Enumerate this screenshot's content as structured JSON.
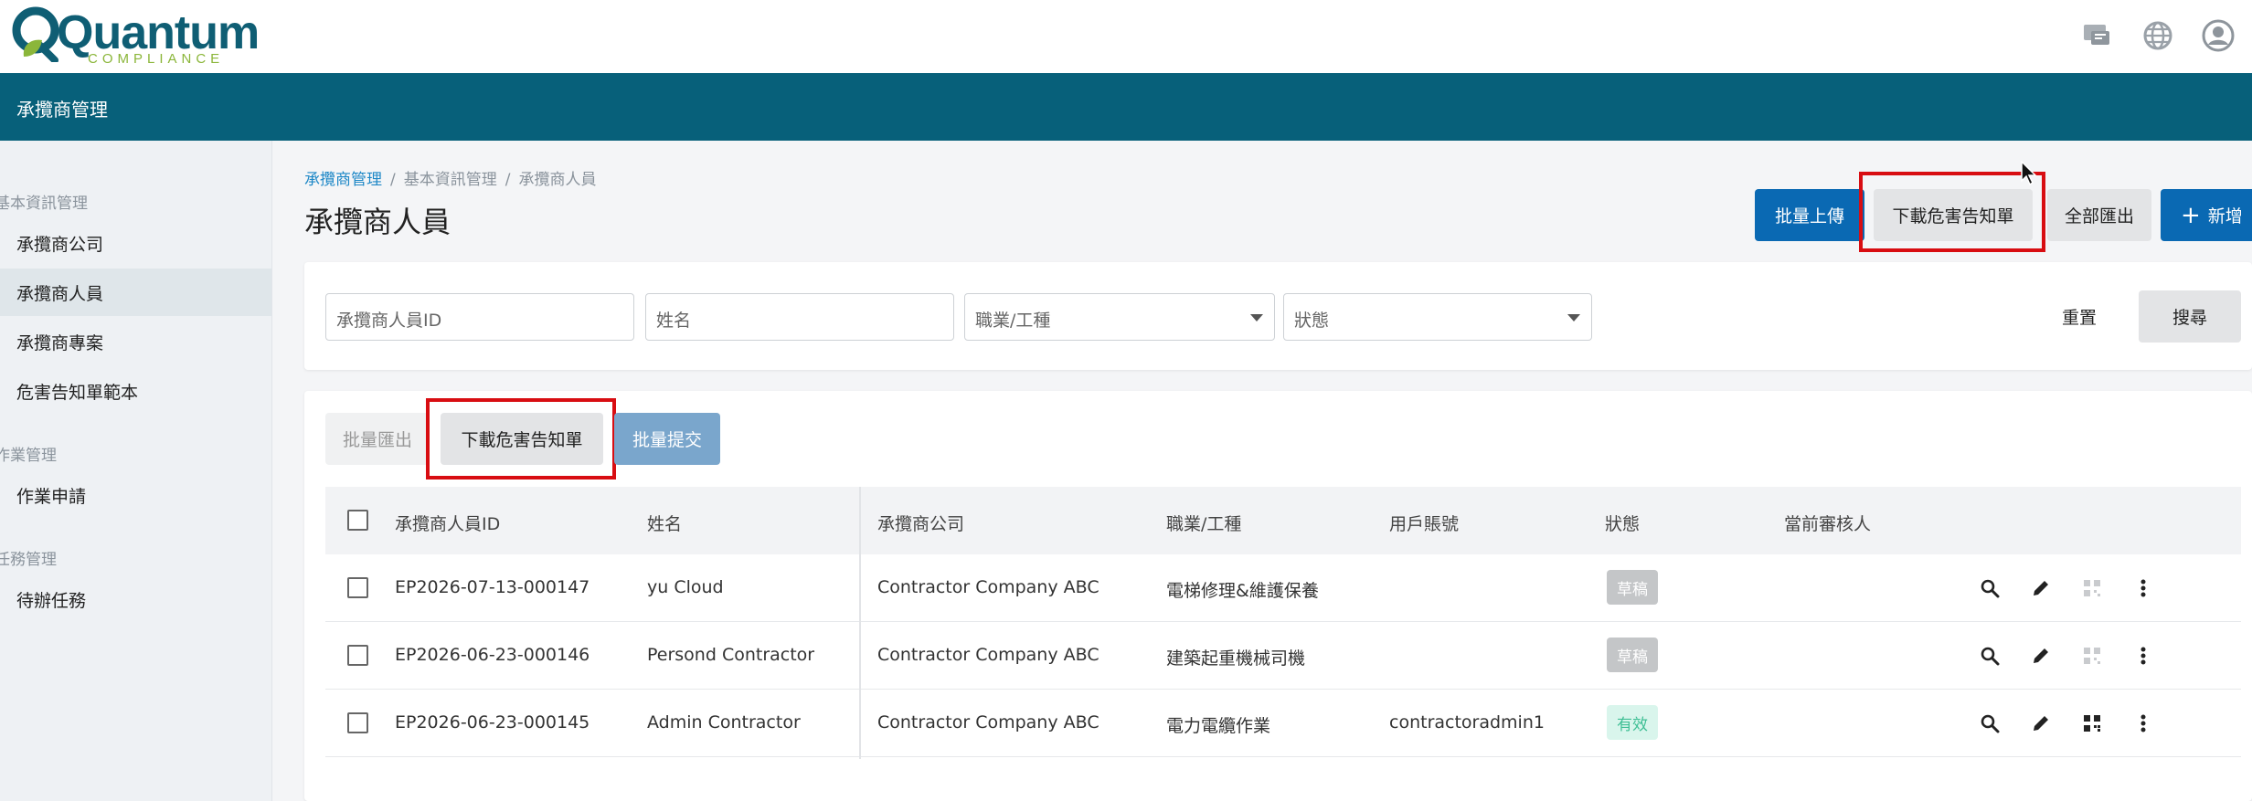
{
  "header": {
    "brand_word": "Quantum",
    "brand_sub": "COMPLIANCE",
    "icons": [
      "message-icon",
      "globe-icon",
      "account-icon"
    ]
  },
  "navbar": {
    "title": "承攬商管理"
  },
  "sidebar": {
    "groups": [
      {
        "label": "基本資訊管理",
        "items": [
          "承攬商公司",
          "承攬商人員",
          "承攬商專案",
          "危害告知單範本"
        ]
      },
      {
        "label": "作業管理",
        "items": [
          "作業申請"
        ]
      },
      {
        "label": "任務管理",
        "items": [
          "待辦任務"
        ]
      }
    ],
    "active_item": "承攬商人員"
  },
  "breadcrumb": [
    "承攬商管理",
    "基本資訊管理",
    "承攬商人員"
  ],
  "page_title": "承攬商人員",
  "toolbar": {
    "batch_upload": "批量上傳",
    "download_notice": "下載危害告知單",
    "export_all": "全部匯出",
    "add_new": "新增"
  },
  "filters": {
    "id_placeholder": "承攬商人員ID",
    "name_placeholder": "姓名",
    "job_placeholder": "職業/工種",
    "status_placeholder": "狀態",
    "reset": "重置",
    "search": "搜尋"
  },
  "batch": {
    "export": "批量匯出",
    "download_notice": "下載危害告知單",
    "submit": "批量提交"
  },
  "table": {
    "columns": [
      "承攬商人員ID",
      "姓名",
      "承攬商公司",
      "職業/工種",
      "用戶賬號",
      "狀態",
      "當前審核人"
    ],
    "rows": [
      {
        "id": "EP2026-07-13-000147",
        "name": "yu Cloud",
        "company": "Contractor Company ABC",
        "job": "電梯修理&維護保養",
        "account": "",
        "status": "草稿",
        "status_type": "draft",
        "qr_enabled": false
      },
      {
        "id": "EP2026-06-23-000146",
        "name": "Persond Contractor",
        "company": "Contractor Company ABC",
        "job": "建築起重機械司機",
        "account": "",
        "status": "草稿",
        "status_type": "draft",
        "qr_enabled": false
      },
      {
        "id": "EP2026-06-23-000145",
        "name": "Admin Contractor",
        "company": "Contractor Company ABC",
        "job": "電力電纜作業",
        "account": "contractoradmin1",
        "status": "有效",
        "status_type": "valid",
        "qr_enabled": true
      }
    ]
  },
  "colors": {
    "brand_teal": "#07607a",
    "primary_blue": "#0a69b3",
    "highlight_red": "#d80d12",
    "logo_green": "#8bb63a"
  }
}
